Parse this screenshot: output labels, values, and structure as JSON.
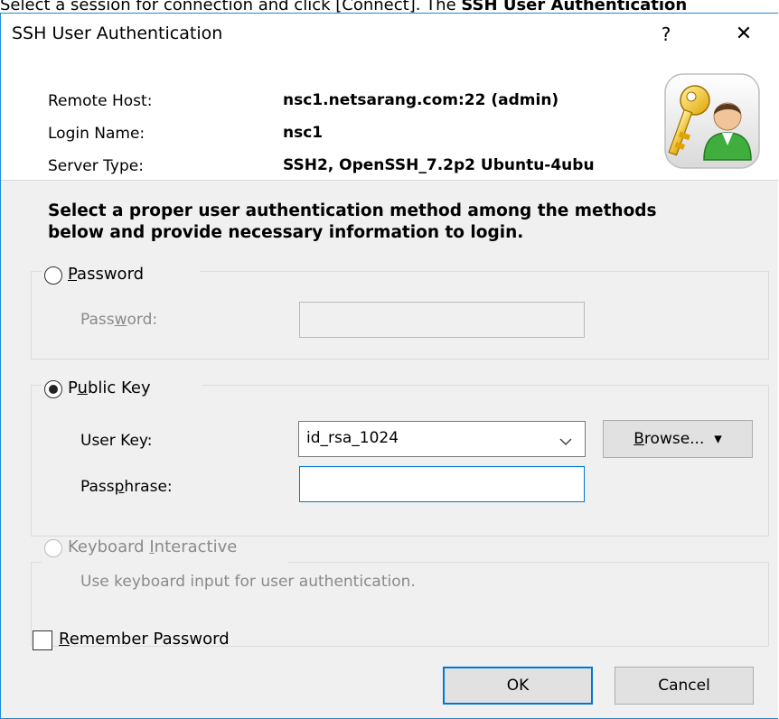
{
  "caption": {
    "text_before": "Select a session for connection and click [Connect]. The ",
    "text_bold": "SSH User Authentication"
  },
  "dialog": {
    "title": "SSH User Authentication",
    "help_glyph": "?",
    "close_glyph": "✕"
  },
  "info": {
    "remote_host_label": "Remote Host:",
    "remote_host_value": "nsc1.netsarang.com:22 (admin)",
    "login_name_label": "Login Name:",
    "login_name_value": "nsc1",
    "server_type_label": "Server Type:",
    "server_type_value": "SSH2, OpenSSH_7.2p2 Ubuntu-4ubu"
  },
  "instruction": {
    "line1": "Select a proper user authentication method among the methods",
    "line2": "below and provide necessary information to login."
  },
  "password_group": {
    "radio_pre": "",
    "radio_ul": "P",
    "radio_post": "assword",
    "field_pre": "Pass",
    "field_ul": "w",
    "field_post": "ord:",
    "value": "",
    "selected": false
  },
  "public_key_group": {
    "radio_pre": "P",
    "radio_ul": "u",
    "radio_post": "blic Key",
    "selected": true,
    "user_key_label": "User Key:",
    "user_key_value": "id_rsa_1024",
    "browse_ul": "B",
    "browse_post": "rowse...",
    "browse_arrow": "▾",
    "passphrase_pre": "Pass",
    "passphrase_ul": "p",
    "passphrase_post": "hrase:",
    "passphrase_value": ""
  },
  "keyboard_group": {
    "radio_pre": "Keyboard ",
    "radio_ul": "I",
    "radio_post": "nteractive",
    "description": "Use keyboard input for user authentication.",
    "selected": false
  },
  "remember_password": {
    "pre": "",
    "ul": "R",
    "post": "emember Password",
    "checked": false
  },
  "buttons": {
    "ok": "OK",
    "cancel": "Cancel"
  },
  "colors": {
    "accent": "#0078d7",
    "dialog_border": "#1f8ad6",
    "panel": "#f0f0f0"
  },
  "icons": {
    "help": "help-icon",
    "close": "close-icon",
    "dropdown": "chevron-down-icon",
    "user_key": "user-key-icon"
  }
}
